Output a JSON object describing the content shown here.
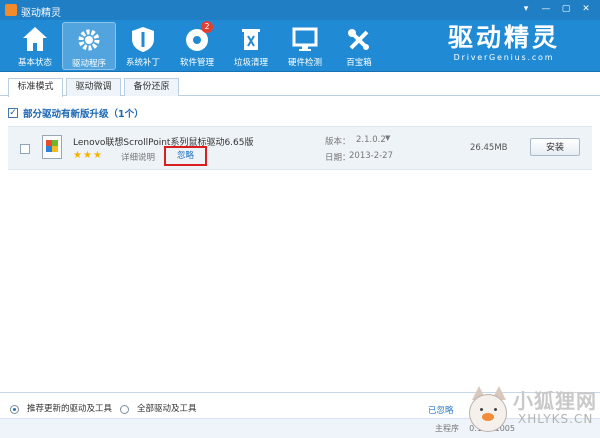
{
  "window": {
    "title": "驱动精灵",
    "controls": [
      "▾",
      "—",
      "▢",
      "✕"
    ]
  },
  "toolbar": {
    "items": [
      {
        "label": "基本状态",
        "icon": "home-icon"
      },
      {
        "label": "驱动程序",
        "icon": "gear-icon"
      },
      {
        "label": "系统补丁",
        "icon": "shield-icon"
      },
      {
        "label": "软件管理",
        "icon": "disc-icon",
        "badge": "2"
      },
      {
        "label": "垃圾清理",
        "icon": "trash-icon"
      },
      {
        "label": "硬件检测",
        "icon": "monitor-icon"
      },
      {
        "label": "百宝箱",
        "icon": "tools-icon"
      }
    ],
    "active_index": 1
  },
  "brand": {
    "logo": "驱动精灵",
    "subtitle": "DriverGenius.com"
  },
  "tabs": [
    "标准模式",
    "驱动微调",
    "备份还原"
  ],
  "group": {
    "title": "部分驱动有新版升级（1个）"
  },
  "driver": {
    "name": "Lenovo联想ScrollPoint系列鼠标驱动6.65版",
    "rating": 3,
    "detail_label": "详细说明",
    "ignore_label": "忽略",
    "version_label": "版本：",
    "version": "2.1.0.2",
    "date_label": "日期：",
    "date": "2013-2-27",
    "size": "26.45MB",
    "install_label": "安装"
  },
  "bottom": {
    "radio_recommended": "推荐更新的驱动及工具",
    "radio_all": "全部驱动及工具",
    "ignored_link": "已忽略",
    "main_program": "主程序",
    "version_tail": "0.128.1005"
  },
  "watermark": {
    "text": "小狐狸网",
    "sub": "XHLYKS.CN"
  },
  "colors": {
    "title_bar": "#1f7ec4",
    "toolbar": "#208bd4",
    "link": "#1f6fc0",
    "highlight": "#d91f1f"
  }
}
